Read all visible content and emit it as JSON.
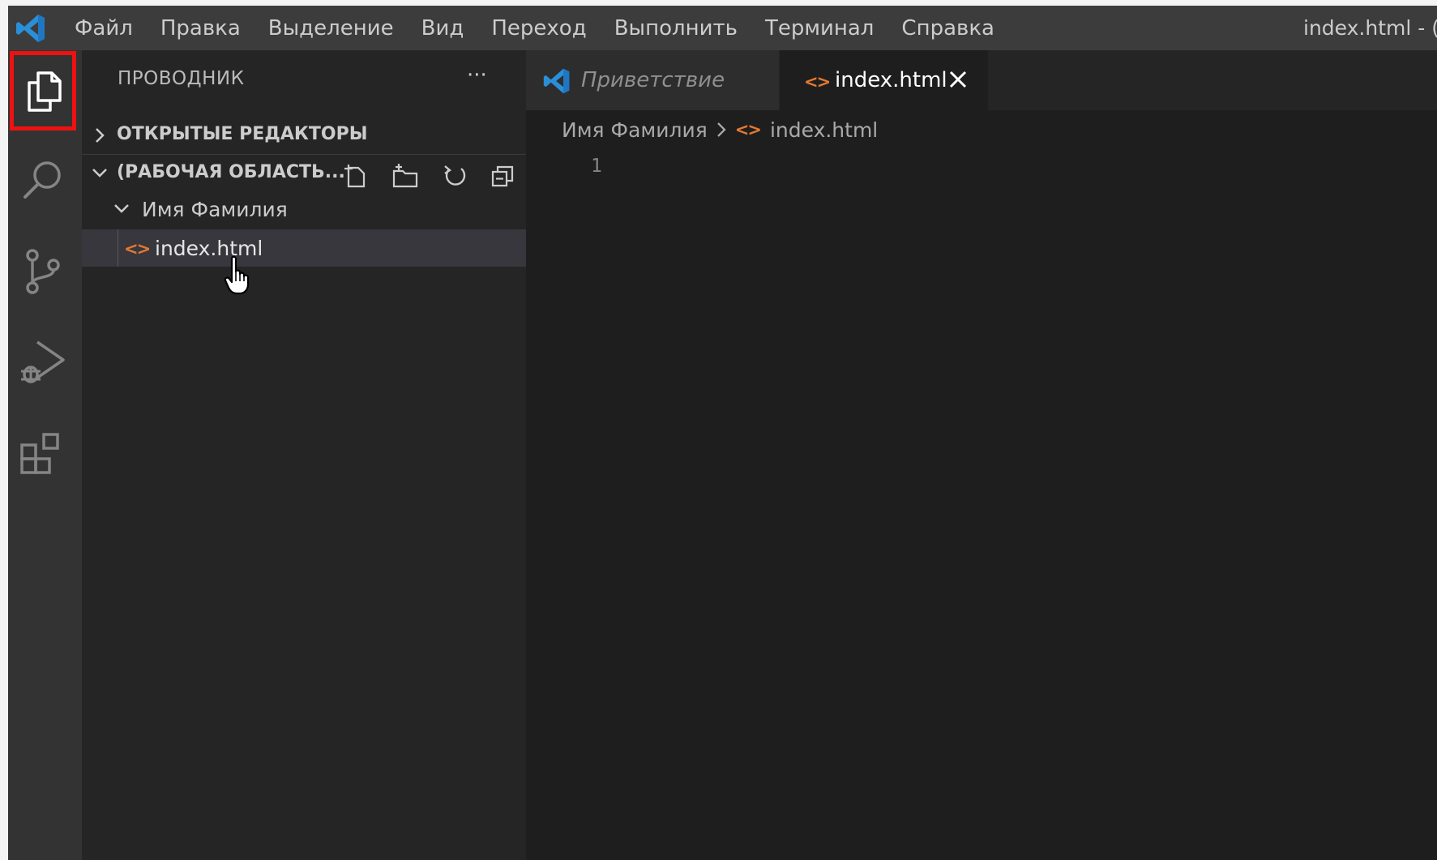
{
  "menu": {
    "items": [
      "Файл",
      "Правка",
      "Выделение",
      "Вид",
      "Переход",
      "Выполнить",
      "Терминал",
      "Справка"
    ],
    "window_title": "index.html - ("
  },
  "activity_bar": {
    "items": [
      {
        "icon": "files-icon",
        "active": true,
        "highlighted": true
      },
      {
        "icon": "search-icon"
      },
      {
        "icon": "source-control-icon"
      },
      {
        "icon": "run-debug-icon"
      },
      {
        "icon": "extensions-icon"
      }
    ],
    "highlight_color": "#ee1111"
  },
  "sidebar": {
    "title": "ПРОВОДНИК",
    "more": "···",
    "open_editors": "ОТКРЫТЫЕ РЕДАКТОРЫ",
    "workspace": "(РАБОЧАЯ ОБЛАСТЬ...",
    "workspace_actions": [
      "new-file-icon",
      "new-folder-icon",
      "refresh-icon",
      "collapse-all-icon"
    ],
    "folder": "Имя Фамилия",
    "file": "index.html"
  },
  "editor": {
    "tabs": [
      {
        "label": "Приветствие",
        "icon": "vscode-logo-icon",
        "active": false
      },
      {
        "label": "index.html",
        "icon": "html-file-icon",
        "active": true
      }
    ],
    "breadcrumb": {
      "folder": "Имя Фамилия",
      "file": "index.html"
    },
    "line_number": "1"
  },
  "icons": {
    "file_icon_glyph": "<>"
  },
  "colors": {
    "accent_blue": "#2a8fd8",
    "html_orange": "#e37933"
  }
}
